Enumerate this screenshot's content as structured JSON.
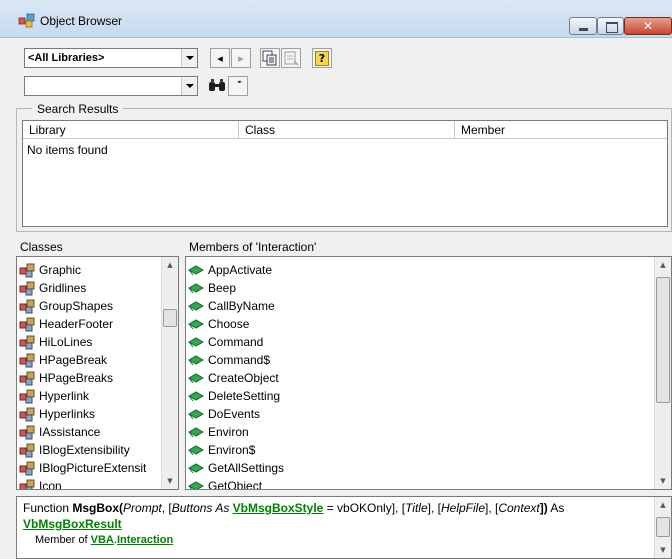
{
  "window": {
    "title": "Object Browser"
  },
  "toolbar": {
    "library_value": "<All Libraries>",
    "search_value": "",
    "nav_back": "◂",
    "nav_forward": "▸",
    "help_glyph": "?",
    "collapse_glyph": "˄˄"
  },
  "search_results": {
    "legend": "Search Results",
    "columns": [
      "Library",
      "Class",
      "Member"
    ],
    "empty_text": "No items found"
  },
  "classes": {
    "header": "Classes",
    "items": [
      "Graphic",
      "Gridlines",
      "GroupShapes",
      "HeaderFooter",
      "HiLoLines",
      "HPageBreak",
      "HPageBreaks",
      "Hyperlink",
      "Hyperlinks",
      "IAssistance",
      "IBlogExtensibility",
      "IBlogPictureExtensit",
      "Icon"
    ]
  },
  "members": {
    "header": "Members of 'Interaction'",
    "items": [
      "AppActivate",
      "Beep",
      "CallByName",
      "Choose",
      "Command",
      "Command$",
      "CreateObject",
      "DeleteSetting",
      "DoEvents",
      "Environ",
      "Environ$",
      "GetAllSettings",
      "GetObject"
    ]
  },
  "details": {
    "prefix": "Function ",
    "func_name": "MsgBox(",
    "p_prompt": "Prompt",
    "sep1": ", [",
    "p_buttons": "Buttons As",
    "space": " ",
    "link_style": "VbMsgBoxStyle",
    "default_val": " = vbOKOnly], [",
    "p_title": "Title",
    "sep2": "], [",
    "p_helpfile": "HelpFile",
    "sep3": "], [",
    "p_context": "Context",
    "close_paren": "])",
    "as_text": " As",
    "link_result": "VbMsgBoxResult",
    "member_of": "Member of ",
    "link_vba": "VBA",
    "dot": ".",
    "link_interaction": "Interaction"
  },
  "colors": {
    "link": "#008000",
    "window_bg": "#f0f0f0",
    "close_button": "#c8452c"
  }
}
